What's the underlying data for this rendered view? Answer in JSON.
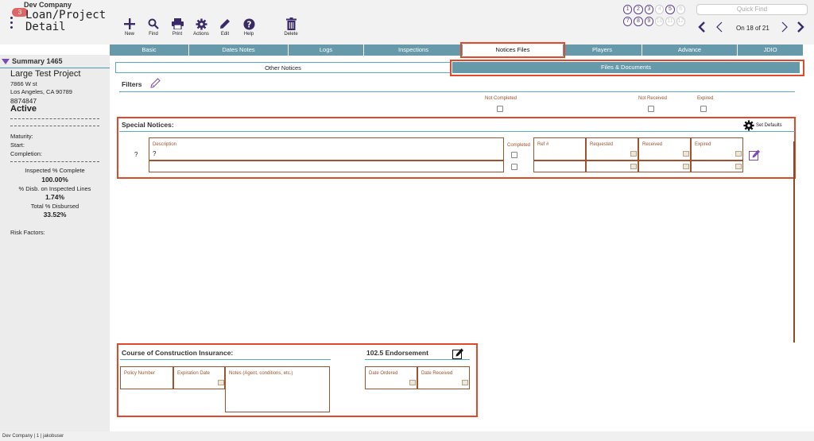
{
  "header": {
    "company": "Dev Company",
    "badge": "3",
    "title_line1": "Loan/Project",
    "title_line2": "Detail",
    "tools": {
      "new": "New",
      "find": "Find",
      "print": "Print",
      "actions": "Actions",
      "edit": "Edit",
      "help": "Help",
      "delete": "Delete"
    },
    "pager_row1": [
      "1",
      "2",
      "3",
      "4",
      "5",
      "6"
    ],
    "pager_row2": [
      "7",
      "8",
      "9",
      "10",
      "11",
      "12"
    ],
    "quickfind_placeholder": "Quick Find",
    "record_position": "On 18 of 21"
  },
  "sidebar": {
    "summary_label": "Summary 1465",
    "project_name": "Large Test Project",
    "address_line1": "7866 W st",
    "address_line2": "Los Angeles, CA  90789",
    "loan_number": "8874847",
    "status": "Active",
    "maturity_label": "Maturity:",
    "start_label": "Start:",
    "completion_label": "Completion:",
    "inspected_label": "Inspected % Complete",
    "inspected_value": "100.00%",
    "disb_label": "% Disb. on Inspected Lines",
    "disb_value": "1.74%",
    "total_label": "Total % Disbursed",
    "total_value": "33.52%",
    "risk_label": "Risk Factors:"
  },
  "tabs": [
    "Basic",
    "Dates Notes",
    "Logs",
    "Inspections",
    "Notices Files",
    "Players",
    "Advance",
    "JDIO"
  ],
  "subtabs": {
    "other": "Other Notices",
    "files": "Files & Documents"
  },
  "filters": {
    "title": "Filters",
    "not_completed": "Not Completed",
    "not_received": "Not Received",
    "expired": "Expired"
  },
  "special_notices": {
    "title": "Special Notices:",
    "set_defaults": "Set Defaults",
    "row_marker": "?",
    "description_label": "Description",
    "description_value": "?",
    "completed_label": "Completed",
    "ref_label": "Ref #",
    "requested_label": "Requested",
    "received_label": "Received",
    "expired_label": "Expired"
  },
  "insurance": {
    "title": "Course of Construction Insurance:",
    "policy_label": "Policy Number",
    "expiration_label": "Expiration Date",
    "notes_label": "Notes (Agent, conditions, etc.)"
  },
  "endorsement": {
    "title": "102.5 Endorsement",
    "ordered_label": "Date Ordered",
    "received_label": "Date Received"
  },
  "footer": {
    "text": "Dev Company | 1 | jakobuser"
  },
  "colors": {
    "tab_bg": "#6699a9",
    "accent": "#5a3b8a",
    "highlight": "#e04a2a",
    "field_border": "#a0522d"
  }
}
